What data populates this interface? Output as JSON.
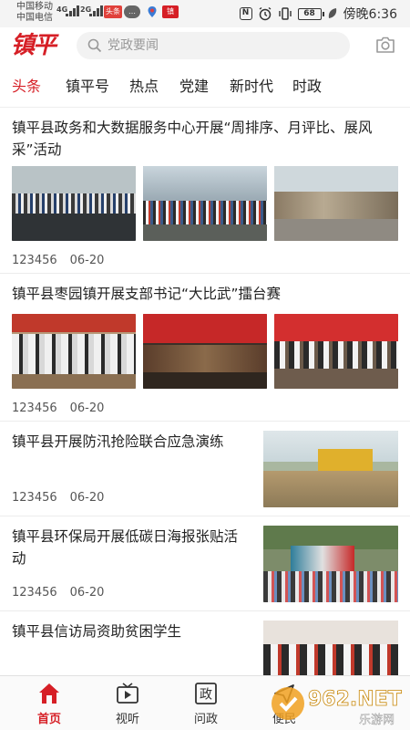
{
  "status_bar": {
    "carrier_1": "中国移动",
    "carrier_2": "中国电信",
    "net_1": "4G",
    "net_2": "2G",
    "app_badge": "头条",
    "battery": "68",
    "time": "傍晚6:36"
  },
  "header": {
    "logo": "镇平",
    "search_placeholder": "党政要闻"
  },
  "tabs": [
    {
      "label": "头条",
      "active": true
    },
    {
      "label": "镇平号",
      "active": false
    },
    {
      "label": "热点",
      "active": false
    },
    {
      "label": "党建",
      "active": false
    },
    {
      "label": "新时代",
      "active": false
    },
    {
      "label": "时政",
      "active": false
    }
  ],
  "articles": [
    {
      "title": "镇平县政务和大数据服务中心开展“周排序、月评比、展风采”活动",
      "views": "123456",
      "date": "06-20"
    },
    {
      "title": "镇平县枣园镇开展支部书记“大比武”擂台赛",
      "views": "123456",
      "date": "06-20"
    },
    {
      "title": "镇平县开展防汛抢险联合应急演练",
      "views": "123456",
      "date": "06-20"
    },
    {
      "title": "镇平县环保局开展低碳日海报张贴活动",
      "views": "123456",
      "date": "06-20"
    },
    {
      "title": "镇平县信访局资助贫困学生",
      "views": "",
      "date": ""
    }
  ],
  "bottom_nav": [
    {
      "label": "首页",
      "icon": "home-icon",
      "active": true
    },
    {
      "label": "视听",
      "icon": "tv-icon",
      "active": false
    },
    {
      "label": "问政",
      "icon": "politics-icon",
      "active": false
    },
    {
      "label": "便民",
      "icon": "service-icon",
      "active": false
    }
  ],
  "watermark": {
    "text": "962.NET",
    "subtext": "乐游网"
  },
  "colors": {
    "accent": "#d61f26",
    "text": "#222222",
    "meta": "#555555"
  }
}
